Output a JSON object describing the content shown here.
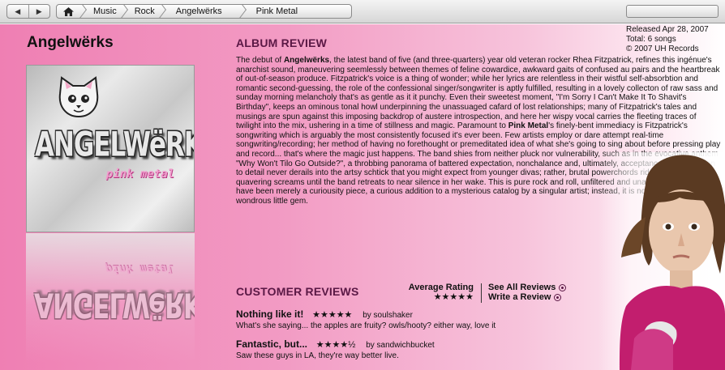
{
  "nav": {
    "back_icon": "back-arrow-icon",
    "forward_icon": "forward-arrow-icon",
    "back_glyph": "◀",
    "forward_glyph": "▶",
    "breadcrumbs": [
      "Music",
      "Rock",
      "Angelwërks",
      "Pink Metal"
    ],
    "home_icon": "home-icon"
  },
  "album": {
    "artist": "Angelwërks",
    "cover_logo": "ANGELWëRKS",
    "cover_subtitle": "pink metal"
  },
  "release": {
    "released": "Released Apr 28, 2007",
    "total": "Total: 6 songs",
    "copyright": "© 2007 UH Records"
  },
  "review": {
    "heading": "ALBUM REVIEW",
    "lines": [
      "The debut of ",
      "Angelwërks",
      ", the latest band of five (and three-quarters) year old veteran rocker Rhea Fitzpatrick, refines this ingénue's anarchist sound, maneuvering seemlessly between themes of feline cowardice, awkward gaits of confused au pairs and the heartbreak of out-of-season produce.  Fitzpatrick's voice is a thing of wonder; while her lyrics are relentless in their wistful self-absorbtion and romantic second-guessing, the role of the confessional singer/songwriter is aptly fulfilled, resulting in a lovely collecton of raw sass and sunday morning melancholy that's as gentle as it it punchy.  Even their sweetest moment, \"I'm Sorry I Can't Make It To Shavit's Birthday\", keeps an ominous tonal howl underpinning the unassuaged cafard of lost relationships; many of Fitzpatrick's tales and musings are spun against this imposing backdrop of austere introspection, and here her wispy vocal carries the fleeting traces of twilight into the mix, ushering in a time of stillness and magic.  Paramount to ",
      "Pink Metal",
      "'s finely-bent immediacy is Fitzpatrick's songwriting which is arguably the most consistently focused it's ever been.  Few artists employ or dare attempt real-time songwriting/recording; her method of having no forethought or premeditated idea of what she's going to sing about before pressing play and record... that's where the magic just happens.  The band shies from neither pluck nor vulnerability, such as in the evocative anthem \"Why Won't Tilo Go Outside?\", a throbbing panorama of battered expectation, nonchalance and, ultimately, acceptance.  This attention to detail never derails into the artsy schtick that you might expect from younger divas; rather, brutal powerchords ride shotgun to quavering screams until the band retreats to near silence in her wake.  This is pure rock and roll, unfiltered and unapologetic.  This could have been merely a curiousity piece, a curious addition to a mysterious catalog by a singular artist; instead, it is nothing less than a wondrous little gem."
    ]
  },
  "customer_reviews": {
    "heading": "CUSTOMER REVIEWS",
    "average_label": "Average Rating",
    "average_stars": "★★★★★",
    "average_rating": 5,
    "see_all": "See All Reviews",
    "write": "Write a Review",
    "items": [
      {
        "title": "Nothing like it!",
        "stars": "★★★★★",
        "rating": 5,
        "by": "by soulshaker",
        "text": "What's she saying... the apples are fruity?  owls/hooty?  either way, love it"
      },
      {
        "title": "Fantastic, but...",
        "stars": "★★★★½",
        "rating": 4.5,
        "by": "by sandwichbucket",
        "text": "Saw these guys in LA, they're way better live."
      }
    ]
  },
  "colors": {
    "heading": "#5a1845",
    "pink": "#ef7fb3"
  }
}
